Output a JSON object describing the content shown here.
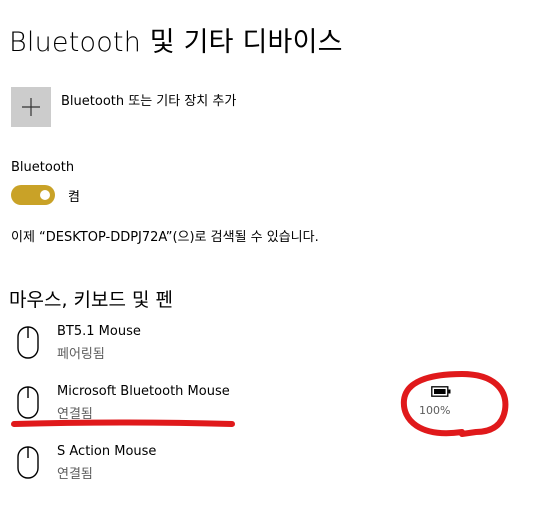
{
  "page": {
    "title": "Bluetooth 및 기타 디바이스"
  },
  "add_device": {
    "label": "Bluetooth 또는 기타 장치 추가",
    "icon": "plus-icon"
  },
  "bluetooth": {
    "label": "Bluetooth",
    "state_label": "켬",
    "is_on": true,
    "discoverable_text": "이제 “DESKTOP-DDPJ72A”(으)로 검색될 수 있습니다."
  },
  "section": {
    "title": "마우스, 키보드 및 펜"
  },
  "devices": [
    {
      "name": "BT5.1 Mouse",
      "status": "페어링됨",
      "icon": "mouse-icon"
    },
    {
      "name": "Microsoft Bluetooth Mouse",
      "status": "연결됨",
      "icon": "mouse-icon",
      "battery": "100%"
    },
    {
      "name": "S Action Mouse",
      "status": "연결됨",
      "icon": "mouse-icon"
    }
  ],
  "colors": {
    "accent": "#c9a227",
    "tile": "#cccccc",
    "annotation": "#e0191b"
  }
}
